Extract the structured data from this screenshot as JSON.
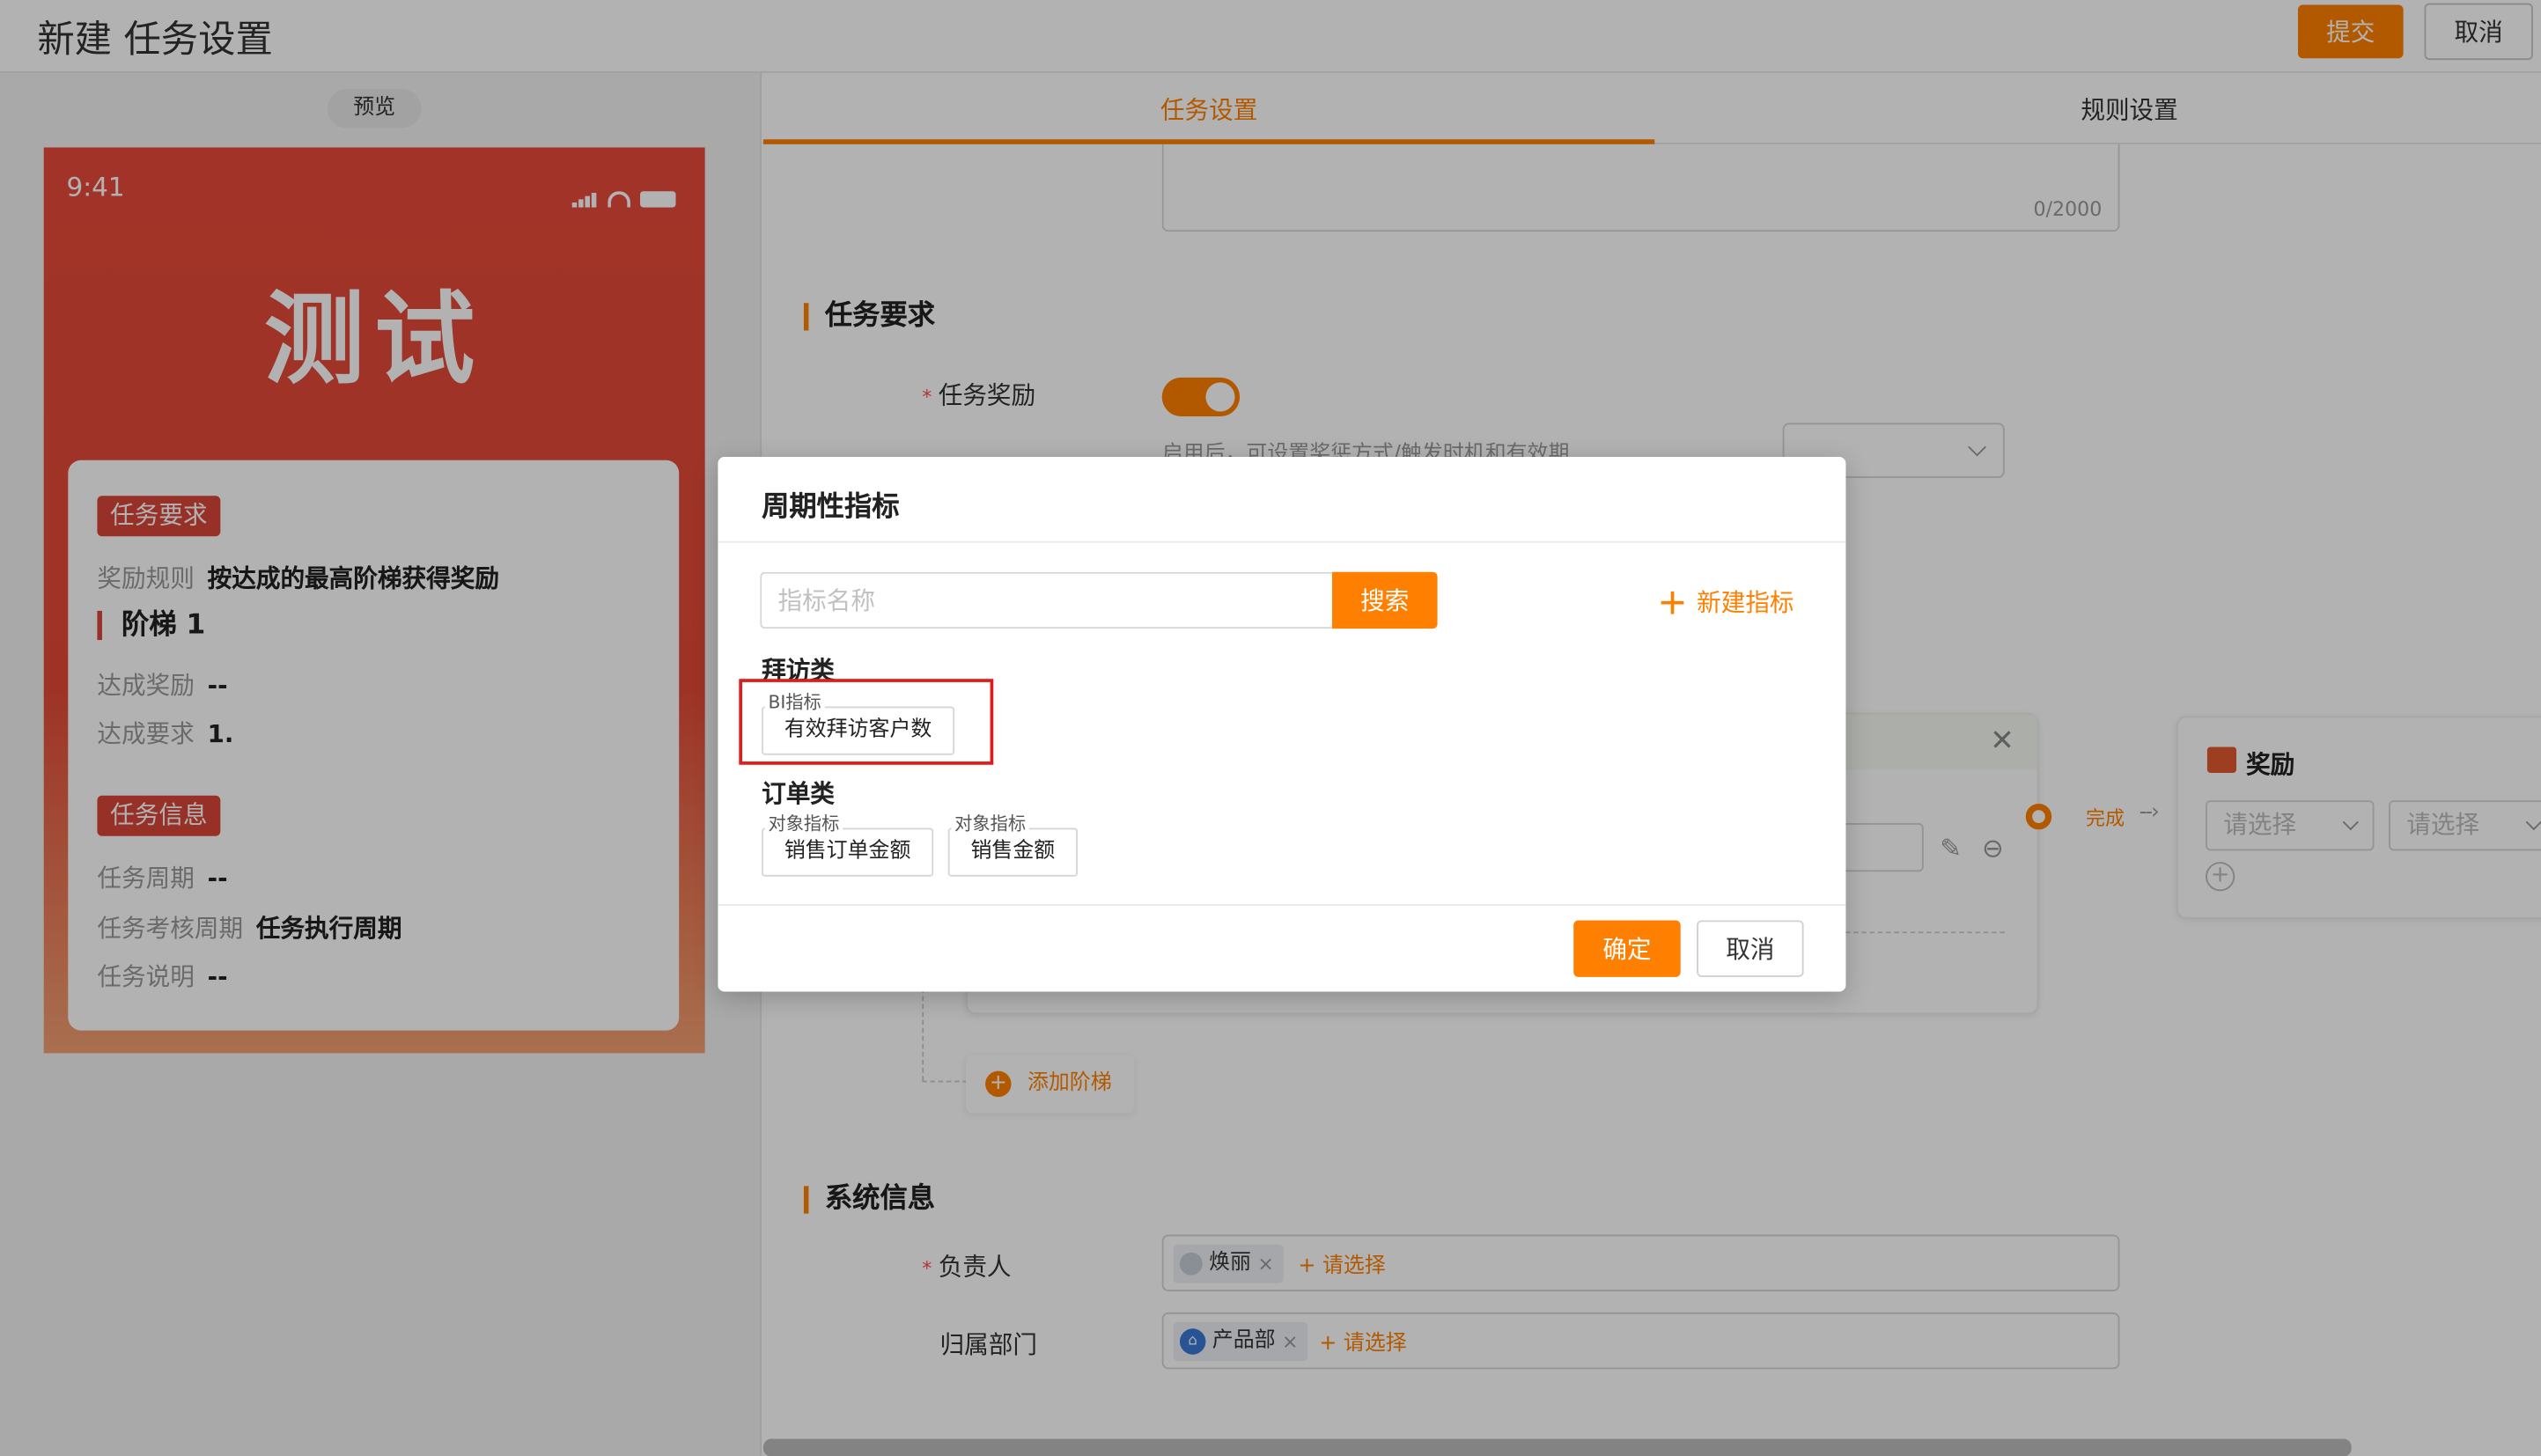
{
  "header": {
    "title": "新建 任务设置",
    "submit_label": "提交",
    "cancel_label": "取消"
  },
  "preview": {
    "pill_label": "预览",
    "time": "9:41",
    "title": "测试",
    "task_req_tag": "任务要求",
    "reward_rule_key": "奖励规则",
    "reward_rule_value": "按达成的最高阶梯获得奖励",
    "stage_label": "阶梯 1",
    "reach_reward_key": "达成奖励",
    "reach_reward_value": "--",
    "reach_req_key": "达成要求",
    "reach_req_value": "1.",
    "task_info_tag": "任务信息",
    "cycle_key": "任务周期",
    "cycle_value": "--",
    "assess_key": "任务考核周期",
    "assess_value": "任务执行周期",
    "desc_key": "任务说明",
    "desc_value": "--"
  },
  "tabs": [
    {
      "label": "任务设置",
      "active": true
    },
    {
      "label": "规则设置",
      "active": false
    }
  ],
  "form": {
    "counter": "0/2000",
    "section_task_req": "任务要求",
    "reward_label": "任务奖励",
    "reward_enabled": true,
    "reward_hint": "启用后，可设置奖惩方式/触发时机和有效期",
    "flow_complete": "完成",
    "reward_card_title": "奖励",
    "reward_select_1": "请选择",
    "reward_select_2": "请选择",
    "add_stage": "添加阶梯",
    "section_system": "系统信息",
    "owner_label": "负责人",
    "owner_chip": "焕丽",
    "owner_add": "+ 请选择",
    "dept_label": "归属部门",
    "dept_chip": "产品部",
    "dept_add": "+ 请选择"
  },
  "modal": {
    "title": "周期性指标",
    "search_placeholder": "指标名称",
    "search_button": "搜索",
    "new_metric": "新建指标",
    "categories": [
      {
        "name": "拜访类",
        "items": [
          {
            "tag": "BI指标",
            "label": "有效拜访客户数"
          }
        ]
      },
      {
        "name": "订单类",
        "items": [
          {
            "tag": "对象指标",
            "label": "销售订单金额"
          },
          {
            "tag": "对象指标",
            "label": "销售金额"
          }
        ]
      }
    ],
    "ok_label": "确定",
    "cancel_label": "取消"
  },
  "colors": {
    "accent": "#ff8000",
    "preview_red": "#d9473a",
    "highlight": "#e11b1b"
  }
}
